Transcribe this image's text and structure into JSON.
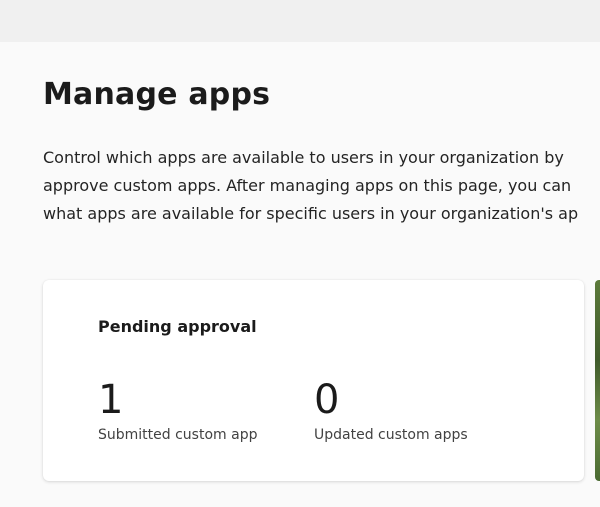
{
  "page": {
    "title": "Manage apps",
    "description_lines": [
      "Control which apps are available to users in your organization by",
      "approve custom apps. After managing apps on this page, you can",
      "what apps are available for specific users in your organization's ap"
    ]
  },
  "pending_card": {
    "title": "Pending approval",
    "stats": [
      {
        "value": "1",
        "label": "Submitted custom app"
      },
      {
        "value": "0",
        "label": "Updated custom apps"
      }
    ]
  }
}
